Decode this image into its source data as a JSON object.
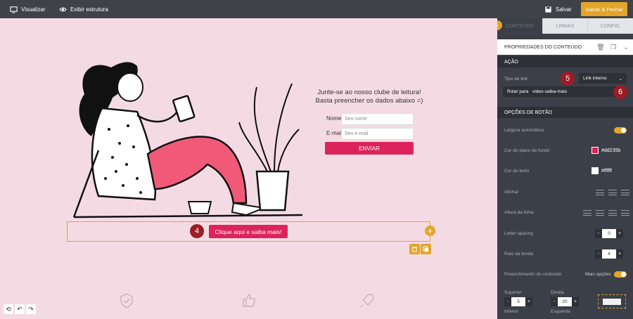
{
  "topbar": {
    "preview_label": "Visualizar",
    "structure_label": "Exibir estrutura",
    "save_label": "Salvar",
    "save_close_label": "Salvar & Fechar"
  },
  "canvas": {
    "headline_line1": "Junte-se ao nosso clube de leitura!",
    "headline_line2": "Basta preencher os dados abaixo =)",
    "name_label": "Nome",
    "name_placeholder": "Seu nome",
    "email_label": "E-mail",
    "email_placeholder": "Seu e-mail",
    "submit_label": "ENVIAR",
    "cta_label": "Clique aqui e saiba mais!",
    "badge_4": "4"
  },
  "panel": {
    "tabs": [
      "CONTEÚDO",
      "LINHAS",
      "CONFIG."
    ],
    "props_title": "PROPRIEDADES DO CONTEÚDO",
    "action_section": "AÇÃO",
    "link_type_label": "Tipo de link",
    "link_type_value": "Link interno",
    "badge_5": "5",
    "scroll_label": "Rolar para",
    "scroll_value": "video-saiba-mais",
    "badge_6": "6",
    "button_options_section": "OPÇÕES DE BOTÃO",
    "auto_width_label": "Largura automática",
    "bg_color_label": "Cor do plano de fundo",
    "bg_color_value": "#dd235b",
    "text_color_label": "Cor do texto",
    "text_color_value": "#ffffff",
    "align_label": "Alinhar",
    "line_height_label": "Altura da linha",
    "letter_spacing_label": "Letter spacing",
    "letter_spacing_value": "0",
    "border_radius_label": "Raio da borda",
    "border_radius_value": "4",
    "padding_label": "Preenchimento do conteúdo",
    "more_options_label": "Mais opções",
    "top_label": "Superior",
    "top_value": "5",
    "right_label": "Direita",
    "right_value": "20",
    "bottom_label": "Inferior",
    "left_label": "Esquerda"
  },
  "colors": {
    "accent": "#e3a52a",
    "brand_pink": "#dd235b",
    "panel_bg": "#3b3f47",
    "canvas_bg": "#f4dbe3"
  }
}
